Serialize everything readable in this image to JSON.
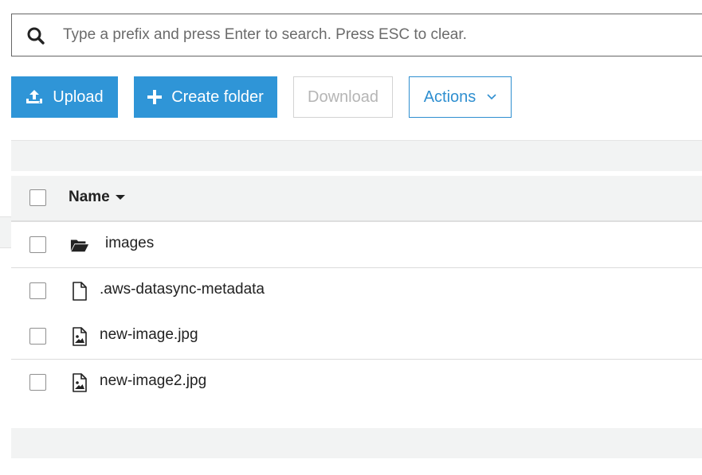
{
  "search": {
    "placeholder": "Type a prefix and press Enter to search. Press ESC to clear.",
    "value": "",
    "icon": "search-icon"
  },
  "toolbar": {
    "upload_label": "Upload",
    "upload_icon": "upload-icon",
    "create_folder_label": "Create folder",
    "create_folder_icon": "plus-icon",
    "download_label": "Download",
    "actions_label": "Actions",
    "actions_icon": "chevron-down-icon"
  },
  "table": {
    "columns": [
      {
        "label": "Name",
        "sort": "descending"
      }
    ],
    "rows": [
      {
        "name": "images",
        "type": "folder",
        "icon": "folder-open-icon"
      },
      {
        "name": ".aws-datasync-metadata",
        "type": "file",
        "icon": "file-icon"
      },
      {
        "name": "new-image.jpg",
        "type": "image",
        "icon": "image-file-icon"
      },
      {
        "name": "new-image2.jpg",
        "type": "image",
        "icon": "image-file-icon"
      }
    ]
  },
  "colors": {
    "primary": "#2f95d7",
    "actions_border": "#2f8fd0",
    "disabled_text": "#b5b5b5",
    "band_bg": "#f2f3f3"
  }
}
